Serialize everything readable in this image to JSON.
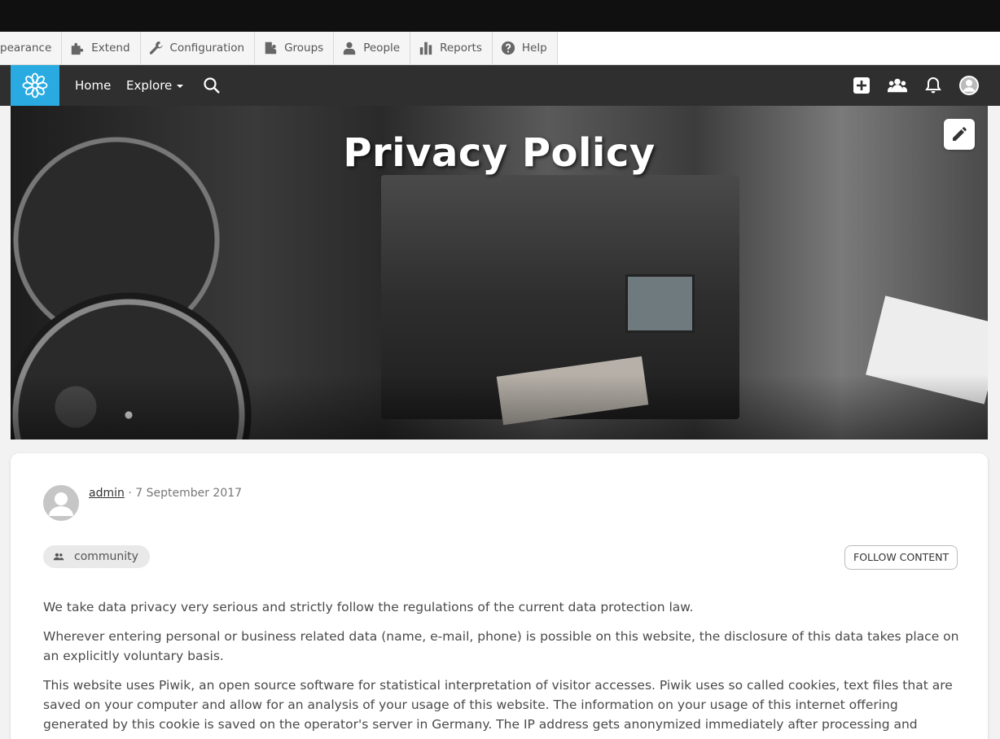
{
  "admin_toolbar": {
    "items": [
      {
        "label": "pearance",
        "icon": "paintbrush-icon"
      },
      {
        "label": "Extend",
        "icon": "puzzle-icon"
      },
      {
        "label": "Configuration",
        "icon": "wrench-icon"
      },
      {
        "label": "Groups",
        "icon": "building-people-icon"
      },
      {
        "label": "People",
        "icon": "person-icon"
      },
      {
        "label": "Reports",
        "icon": "bar-chart-icon"
      },
      {
        "label": "Help",
        "icon": "question-icon"
      }
    ]
  },
  "navbar": {
    "home": "Home",
    "explore": "Explore",
    "brand_color": "#29abe2"
  },
  "hero": {
    "title": "Privacy Policy"
  },
  "post": {
    "author": "admin",
    "date": "· 7 September 2017",
    "group": "community",
    "follow_label": "FOLLOW CONTENT",
    "paragraphs": [
      "We take data privacy very serious and strictly follow the regulations of the current data protection law.",
      "Wherever entering personal or business related data (name, e-mail, phone) is possible on this website, the disclosure of this data takes place on an explicitly voluntary basis.",
      "This website uses Piwik, an open source software for statistical interpretation of visitor accesses. Piwik uses so called cookies, text files that are saved on your computer and allow for an analysis of your usage of this website. The information on your usage of this internet offering generated by this cookie is saved on the operator's server in Germany. The IP address gets anonymized immediately after processing and"
    ]
  }
}
